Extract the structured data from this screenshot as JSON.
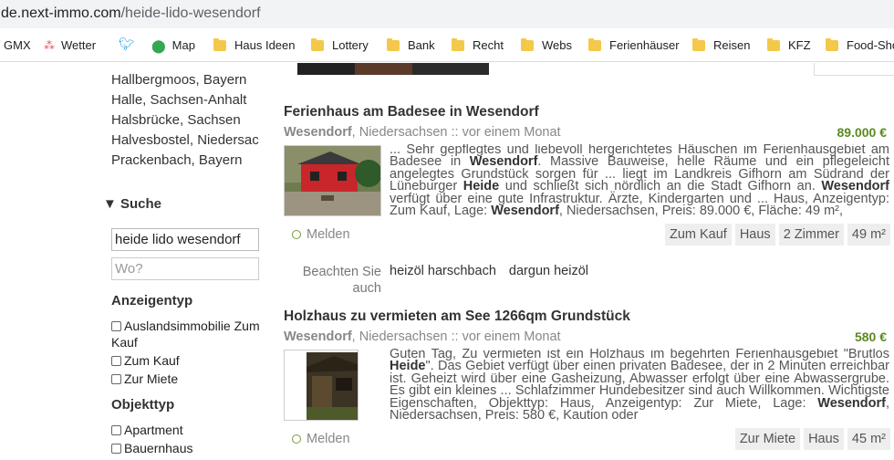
{
  "browser": {
    "url_domain": "de.next-immo.com",
    "url_path": "/heide-lido-wesendorf",
    "bookmarks": [
      {
        "label": "GMX",
        "icon": "none"
      },
      {
        "label": "Wetter",
        "icon": "sparkle-icon"
      },
      {
        "label": "",
        "icon": "twitter-icon"
      },
      {
        "label": "Map",
        "icon": "map-pin-icon"
      },
      {
        "label": "Haus Ideen",
        "icon": "folder-icon"
      },
      {
        "label": "Lottery",
        "icon": "folder-icon"
      },
      {
        "label": "Bank",
        "icon": "folder-icon"
      },
      {
        "label": "Recht",
        "icon": "folder-icon"
      },
      {
        "label": "Webs",
        "icon": "folder-icon"
      },
      {
        "label": "Ferienhäuser",
        "icon": "folder-icon"
      },
      {
        "label": "Reisen",
        "icon": "folder-icon"
      },
      {
        "label": "KFZ",
        "icon": "folder-icon"
      },
      {
        "label": "Food-Sho",
        "icon": "folder-icon"
      }
    ]
  },
  "sidebar": {
    "locations": [
      "Hallbergmoos, Bayern",
      "Halle, Sachsen-Anhalt",
      "Halsbrücke, Sachsen",
      "Halvesbostel, Niedersachsen",
      "Prackenbach, Bayern"
    ],
    "search_heading": "▼ Suche",
    "search_value": "heide lido wesendorf",
    "where_placeholder": "Wo?",
    "ad_type_heading": "Anzeigentyp",
    "ad_types": [
      "Auslandsimmobilie Zum Kauf",
      "Zum Kauf",
      "Zur Miete"
    ],
    "object_type_heading": "Objekttyp",
    "object_types": [
      "Apartment",
      "Bauernhaus"
    ]
  },
  "listings": [
    {
      "title": "Ferienhaus am Badesee in Wesendorf",
      "city": "Wesendorf",
      "meta_rest": ", Niedersachsen :: vor einem Monat",
      "price": "89.000 €",
      "description_html": "... Sehr gepflegtes und liebevoll hergerichtetes Häuschen im Ferienhausgebiet am Badesee in <b>Wesendorf</b>. Massive Bauweise, helle Räume und ein pflegeleicht angelegtes Grundstück sorgen für ... liegt im Landkreis Gifhorn am Südrand der Lüneburger <b>Heide</b> und schließt sich nördlich an die Stadt Gifhorn an. <b>Wesendorf</b> verfügt über eine gute Infrastruktur. Ärzte, Kindergarten und ... Haus, Anzeigentyp: Zum Kauf, Lage: <b>Wesendorf</b>, Niedersachsen, Preis: 89.000 €, Fläche: 49 m²,",
      "report": "Melden",
      "tags": [
        "Zum Kauf",
        "Haus",
        "2 Zimmer",
        "49 m²"
      ]
    },
    {
      "title": "Holzhaus zu vermieten am See 1266qm Grundstück",
      "city": "Wesendorf",
      "meta_rest": ", Niedersachsen :: vor einem Monat",
      "price": "580 €",
      "description_html": "Guten Tag, Zu vermieten ist ein Holzhaus im begehrten Ferienhausgebiet \"Brutlos <b>Heide</b>\". Das Gebiet verfügt über einen privaten Badesee, der in 2 Minuten erreichbar ist. Geheizt wird über eine Gasheizung, Abwasser erfolgt über eine Abwassergrube. Es gibt ein kleines ... Schlafzimmer Hundebesitzer sind auch Willkommen. Wichtigste Eigenschaften, Objekttyp: Haus, Anzeigentyp: Zur Miete, Lage: <b>Wesendorf</b>, Niedersachsen, Preis: 580 €, Kaution oder",
      "report": "Melden",
      "tags": [
        "Zur Miete",
        "Haus",
        "45 m²"
      ]
    }
  ],
  "see_also": {
    "label": "Beachten Sie auch",
    "links": [
      "heizöl harschbach",
      "dargun heizöl"
    ]
  },
  "colors": {
    "price": "#5b8a1f",
    "folder": "#f4c84a"
  }
}
